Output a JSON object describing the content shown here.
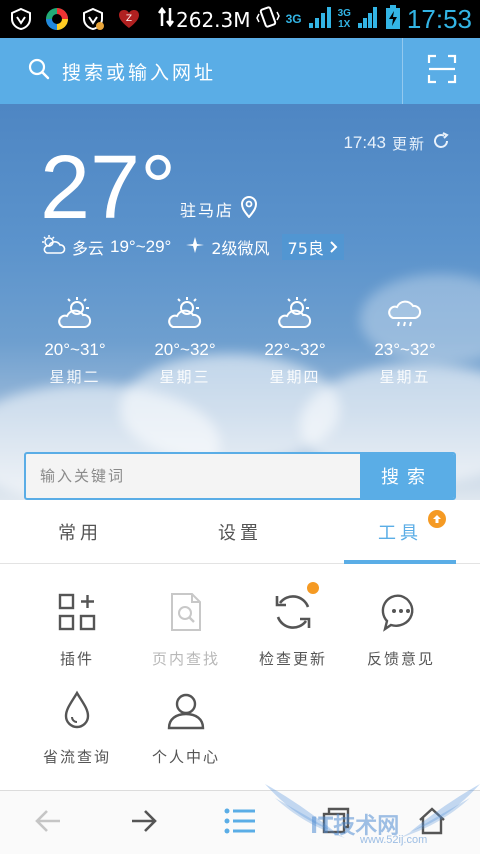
{
  "status_bar": {
    "traffic": "262.3M",
    "network": "3G",
    "network_small": "3G",
    "network_small2": "1X",
    "time": "17:53",
    "icons": [
      "vpn-shield-icon",
      "colorful-app-icon",
      "shield-notify-icon",
      "z-app-icon",
      "data-transfer-icon",
      "vibrate-icon",
      "signal-icon",
      "battery-charging-icon"
    ]
  },
  "search": {
    "placeholder": "搜索或输入网址",
    "icon": "search-icon",
    "scan_icon": "scan-icon"
  },
  "weather": {
    "updated_time": "17:43",
    "updated_label": "更新",
    "temperature": "27°",
    "location": "驻马店",
    "condition": "多云",
    "range": "19°~29°",
    "wind": "2级微风",
    "aqi": "75良",
    "forecast": [
      {
        "range": "20°~31°",
        "day": "星期二",
        "icon": "partly-cloudy-icon"
      },
      {
        "range": "20°~32°",
        "day": "星期三",
        "icon": "partly-cloudy-icon"
      },
      {
        "range": "22°~32°",
        "day": "星期四",
        "icon": "partly-cloudy-icon"
      },
      {
        "range": "23°~32°",
        "day": "星期五",
        "icon": "rain-icon"
      }
    ]
  },
  "keyword_search": {
    "placeholder": "输入关键词",
    "button": "搜索"
  },
  "tabs": [
    {
      "label": "常用"
    },
    {
      "label": "设置"
    },
    {
      "label": "工具"
    }
  ],
  "tools": [
    {
      "label": "插件",
      "icon": "plugin-icon"
    },
    {
      "label": "页内查找",
      "icon": "find-in-page-icon"
    },
    {
      "label": "检查更新",
      "icon": "refresh-update-icon"
    },
    {
      "label": "反馈意见",
      "icon": "feedback-icon"
    },
    {
      "label": "省流查询",
      "icon": "data-saving-icon"
    },
    {
      "label": "个人中心",
      "icon": "user-icon"
    }
  ],
  "bottom_nav": [
    "back-icon",
    "forward-icon",
    "menu-icon",
    "tabs-icon",
    "home-icon"
  ],
  "watermark": {
    "text": "IT技术网",
    "sub": "www.52ij.com"
  },
  "colors": {
    "accent": "#5aade6",
    "badge": "#f59a23",
    "status_time": "#33b5e5"
  }
}
